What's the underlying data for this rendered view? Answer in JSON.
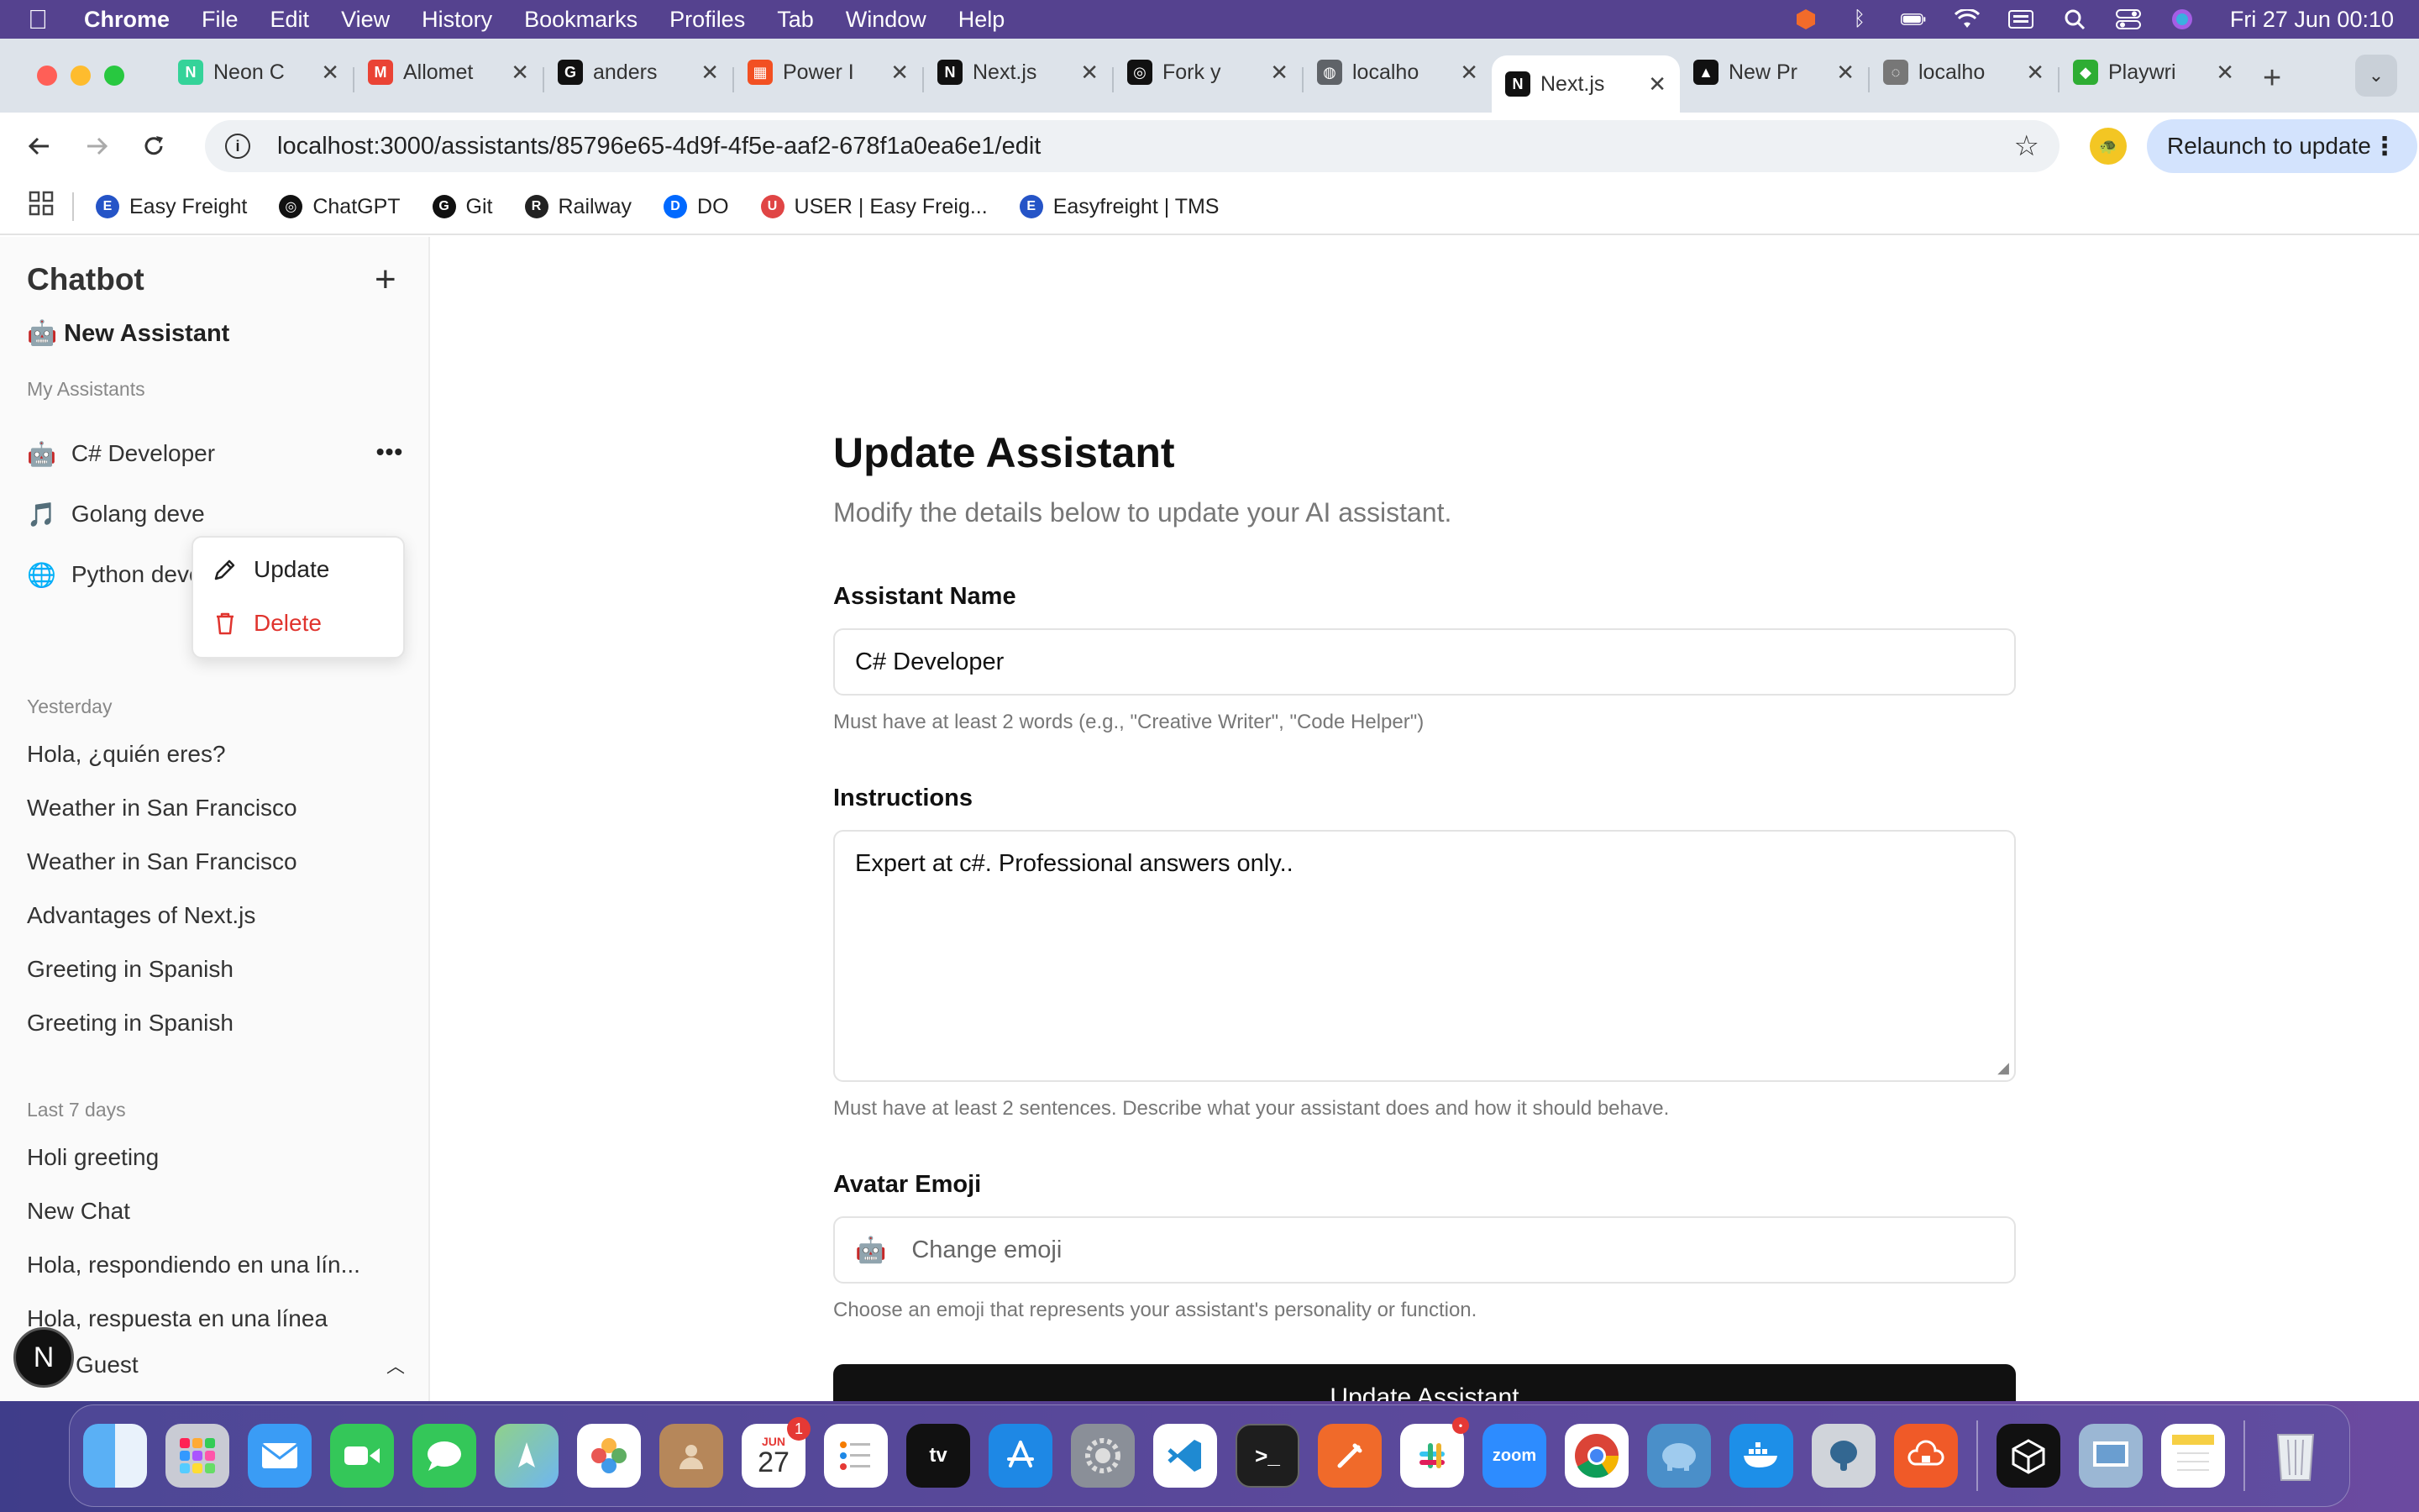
{
  "menubar": {
    "app_name": "Chrome",
    "items": [
      "File",
      "Edit",
      "View",
      "History",
      "Bookmarks",
      "Profiles",
      "Tab",
      "Window",
      "Help"
    ],
    "clock": "Fri 27 Jun  00:10"
  },
  "tabs": [
    {
      "title": "Neon C",
      "favicon_color": "#34d399",
      "favicon_glyph": "N"
    },
    {
      "title": "Allomet",
      "favicon_color": "#ea4335",
      "favicon_glyph": "M"
    },
    {
      "title": "anders",
      "favicon_color": "#111111",
      "favicon_glyph": "G"
    },
    {
      "title": "Power I",
      "favicon_color": "#f25022",
      "favicon_glyph": "▦"
    },
    {
      "title": "Next.js",
      "favicon_color": "#111111",
      "favicon_glyph": "N"
    },
    {
      "title": "Fork y",
      "favicon_color": "#111111",
      "favicon_glyph": "◎"
    },
    {
      "title": "localho",
      "favicon_color": "#5f6368",
      "favicon_glyph": "◍"
    },
    {
      "title": "Next.js",
      "favicon_color": "#111111",
      "favicon_glyph": "N",
      "active": true
    },
    {
      "title": "New Pr",
      "favicon_color": "#111111",
      "favicon_glyph": "▲"
    },
    {
      "title": "localho",
      "favicon_color": "#777777",
      "favicon_glyph": "◌"
    },
    {
      "title": "Playwri",
      "favicon_color": "#2ead33",
      "favicon_glyph": "◆"
    }
  ],
  "toolbar": {
    "url": "localhost:3000/assistants/85796e65-4d9f-4f5e-aaf2-678f1a0ea6e1/edit",
    "relaunch_label": "Relaunch to update"
  },
  "bookmarks": [
    {
      "label": "Easy Freight",
      "color": "#2554c7",
      "glyph": "E"
    },
    {
      "label": "ChatGPT",
      "color": "#111111",
      "glyph": "◎"
    },
    {
      "label": "Git",
      "color": "#111111",
      "glyph": "G"
    },
    {
      "label": "Railway",
      "color": "#222222",
      "glyph": "R"
    },
    {
      "label": "DO",
      "color": "#0069ff",
      "glyph": "D"
    },
    {
      "label": "USER | Easy Freig...",
      "color": "#e04545",
      "glyph": "U"
    },
    {
      "label": "Easyfreight | TMS",
      "color": "#2554c7",
      "glyph": "E"
    }
  ],
  "sidebar": {
    "title": "Chatbot",
    "new_assistant": "🤖 New Assistant",
    "my_assistants_label": "My Assistants",
    "assistants": [
      {
        "emoji": "🤖",
        "name": "C# Developer"
      },
      {
        "emoji": "🎵",
        "name": "Golang deve"
      },
      {
        "emoji": "🌐",
        "name": "Python deve"
      }
    ],
    "yesterday_label": "Yesterday",
    "yesterday": [
      "Hola, ¿quién eres?",
      "Weather in San Francisco",
      "Weather in San Francisco",
      "Advantages of Next.js",
      "Greeting in Spanish",
      "Greeting in Spanish"
    ],
    "last7_label": "Last 7 days",
    "last7": [
      "Holi greeting",
      "New Chat",
      "Hola, respondiendo en una lín...",
      "Hola, respuesta en una línea"
    ],
    "user_name": "Guest",
    "n_badge": "N"
  },
  "context_menu": {
    "update": "Update",
    "delete": "Delete"
  },
  "form": {
    "title": "Update Assistant",
    "subtitle": "Modify the details below to update your AI assistant.",
    "name_label": "Assistant Name",
    "name_value": "C# Developer",
    "name_help": "Must have at least 2 words (e.g., \"Creative Writer\", \"Code Helper\")",
    "instructions_label": "Instructions",
    "instructions_value": "Expert at c#. Professional answers only..",
    "instructions_help": "Must have at least 2 sentences. Describe what your assistant does and how it should behave.",
    "avatar_label": "Avatar Emoji",
    "avatar_emoji": "🤖",
    "avatar_placeholder": "Change emoji",
    "avatar_help": "Choose an emoji that represents your assistant's personality or function.",
    "submit_label": "Update Assistant"
  },
  "dock": {
    "calendar_month": "JUN",
    "calendar_day": "27",
    "calendar_badge": "1",
    "apps": [
      "finder",
      "launchpad",
      "mail",
      "facetime",
      "messages",
      "maps",
      "photos",
      "contacts",
      "calendar",
      "reminders",
      "tv",
      "app-store",
      "system-settings",
      "vscode",
      "terminal",
      "postman",
      "slack",
      "zoom",
      "chrome",
      "tableplus",
      "docker",
      "pgadmin",
      "cloud-app",
      "cube-app",
      "preview",
      "notes",
      "trash"
    ],
    "tv_label": "tv",
    "zoom_label": "zoom"
  }
}
